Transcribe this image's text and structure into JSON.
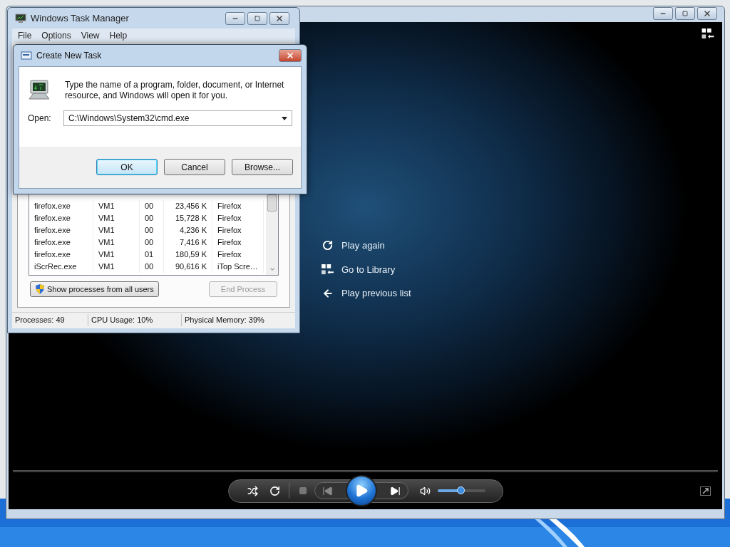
{
  "task_manager": {
    "title": "Windows Task Manager",
    "menu": [
      "File",
      "Options",
      "View",
      "Help"
    ],
    "rows": [
      {
        "cells": [
          "firefox.exe",
          "VM1",
          "00",
          "23,456 K",
          "Firefox"
        ]
      },
      {
        "cells": [
          "firefox.exe",
          "VM1",
          "00",
          "15,728 K",
          "Firefox"
        ]
      },
      {
        "cells": [
          "firefox.exe",
          "VM1",
          "00",
          "4,236 K",
          "Firefox"
        ]
      },
      {
        "cells": [
          "firefox.exe",
          "VM1",
          "00",
          "7,416 K",
          "Firefox"
        ]
      },
      {
        "cells": [
          "firefox.exe",
          "VM1",
          "01",
          "180,59 K",
          "Firefox"
        ]
      },
      {
        "cells": [
          "iScrRec.exe",
          "VM1",
          "00",
          "90,616 K",
          "iTop Scre…"
        ]
      }
    ],
    "show_all_button": "Show processes from all users",
    "end_process": {
      "label": "End Process",
      "disabled": true
    },
    "status": [
      "Processes: 49",
      "CPU Usage: 10%",
      "Physical Memory: 39%"
    ]
  },
  "dialog": {
    "title": "Create New Task",
    "message": "Type the name of a program, folder, document, or Internet resource, and Windows will open it for you.",
    "open_label": "Open:",
    "open_value": "C:\\Windows\\System32\\cmd.exe",
    "buttons": [
      {
        "label": "OK",
        "default": true
      },
      {
        "label": "Cancel",
        "default": false
      },
      {
        "label": "Browse...",
        "default": false
      }
    ]
  },
  "player": {
    "actions": [
      {
        "kind": "replay",
        "label": "Play again"
      },
      {
        "kind": "library",
        "label": "Go to Library"
      },
      {
        "kind": "back",
        "label": "Play previous list"
      }
    ],
    "volume": {
      "level": 0.48
    }
  }
}
